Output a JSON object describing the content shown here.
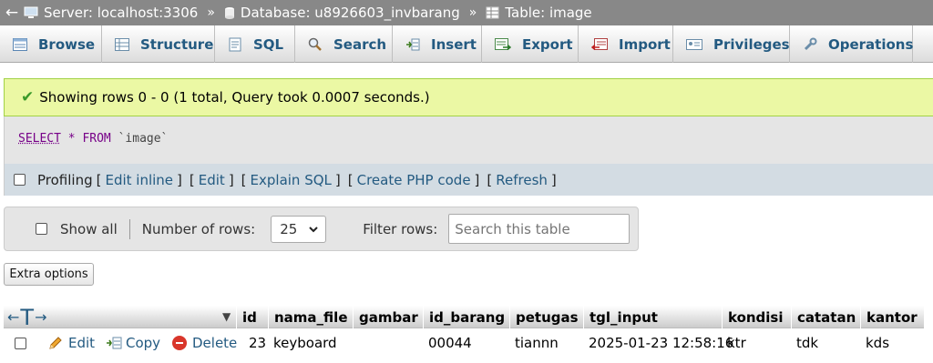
{
  "breadcrumb": {
    "back": "←",
    "items": [
      {
        "icon": "server-icon",
        "label": "Server: localhost:3306"
      },
      {
        "icon": "database-icon",
        "label": "Database: u8926603_invbarang"
      },
      {
        "icon": "table-icon",
        "label": "Table: image"
      }
    ],
    "separator": "»"
  },
  "tabs": [
    {
      "icon": "browse-icon",
      "label": "Browse"
    },
    {
      "icon": "structure-icon",
      "label": "Structure"
    },
    {
      "icon": "sql-icon",
      "label": "SQL"
    },
    {
      "icon": "search-icon",
      "label": "Search"
    },
    {
      "icon": "insert-icon",
      "label": "Insert"
    },
    {
      "icon": "export-icon",
      "label": "Export"
    },
    {
      "icon": "import-icon",
      "label": "Import"
    },
    {
      "icon": "privileges-icon",
      "label": "Privileges"
    },
    {
      "icon": "operations-icon",
      "label": "Operations"
    }
  ],
  "message": {
    "text": "Showing rows 0 - 0 (1 total, Query took 0.0007 seconds.)"
  },
  "sql": {
    "select": "SELECT",
    "star": "*",
    "from": "FROM",
    "table": "`image`"
  },
  "profiling": {
    "label": "Profiling",
    "links": [
      "Edit inline",
      "Edit",
      "Explain SQL",
      "Create PHP code",
      "Refresh"
    ]
  },
  "nav": {
    "show_all": "Show all",
    "rows_label": "Number of rows:",
    "rows_value": "25",
    "filter_label": "Filter rows:",
    "filter_placeholder": "Search this table"
  },
  "extra_options": "Extra options",
  "table": {
    "columns": [
      "id",
      "nama_file",
      "gambar",
      "id_barang",
      "petugas",
      "tgl_input",
      "kondisi",
      "catatan",
      "kantor"
    ],
    "actions": {
      "edit": "Edit",
      "copy": "Copy",
      "delete": "Delete"
    },
    "rows": [
      [
        "23",
        "keyboard",
        "",
        "00044",
        "tiannn",
        "2025-01-23 12:58:16",
        "ktr",
        "tdk",
        "kds"
      ]
    ]
  },
  "colors": {
    "link": "#235a81",
    "success_bg": "#ebf8a4",
    "breadcrumb_bg": "#888888",
    "delete_red": "#d9362b"
  }
}
